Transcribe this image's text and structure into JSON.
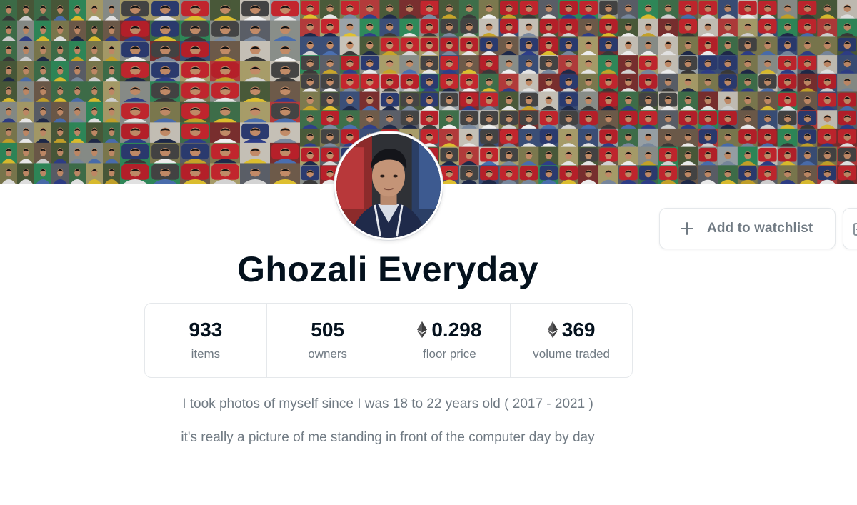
{
  "collection": {
    "name": "Ghozali Everyday",
    "description_lines": [
      "I took photos of myself since I was 18 to 22 years old ( 2017 - 2021 )",
      "it's really a picture of me standing in front of the computer day by day"
    ]
  },
  "actions": {
    "watchlist_label": "Add to watchlist"
  },
  "stats": [
    {
      "value": "933",
      "label": "items",
      "currency_icon": ""
    },
    {
      "value": "505",
      "label": "owners",
      "currency_icon": ""
    },
    {
      "value": "0.298",
      "label": "floor price",
      "currency_icon": "ethereum-icon"
    },
    {
      "value": "369",
      "label": "volume traded",
      "currency_icon": "ethereum-icon"
    }
  ],
  "colors": {
    "text_primary": "#04111d",
    "text_secondary": "#707a83",
    "border": "#e5e8eb"
  }
}
